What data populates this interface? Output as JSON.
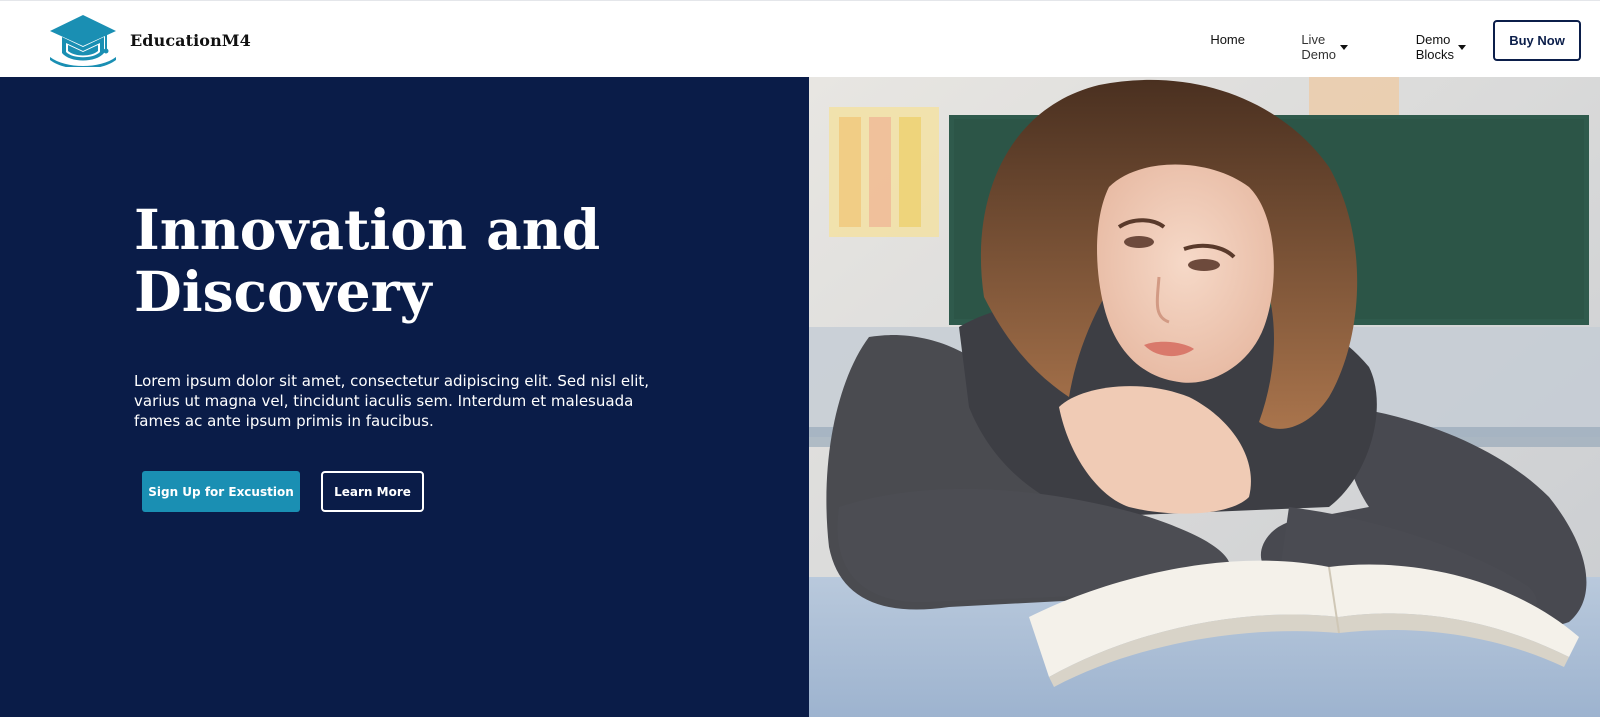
{
  "brand": {
    "name": "EducationM4",
    "logo_icon": "graduation-cap-icon",
    "logo_color": "#1a8fb3"
  },
  "nav": {
    "items": [
      {
        "label": "Home",
        "dropdown": false
      },
      {
        "label": "Live Demo",
        "dropdown": true
      },
      {
        "label": "Demo Blocks",
        "dropdown": true
      }
    ],
    "cta_label": "Buy Now"
  },
  "hero": {
    "title_line1": "Innovation and",
    "title_line2": "Discovery",
    "text": "Lorem ipsum dolor sit amet, consectetur adipiscing elit. Sed nisl elit, varius ut magna vel, tincidunt iaculis sem. Interdum et malesuada fames ac ante ipsum primis in faucibus.",
    "primary_button": "Sign Up for Excustion",
    "secondary_button": "Learn More",
    "background_color": "#0a1c48",
    "accent_color": "#1a8fb3",
    "photo": "student-reading-book-photo"
  }
}
